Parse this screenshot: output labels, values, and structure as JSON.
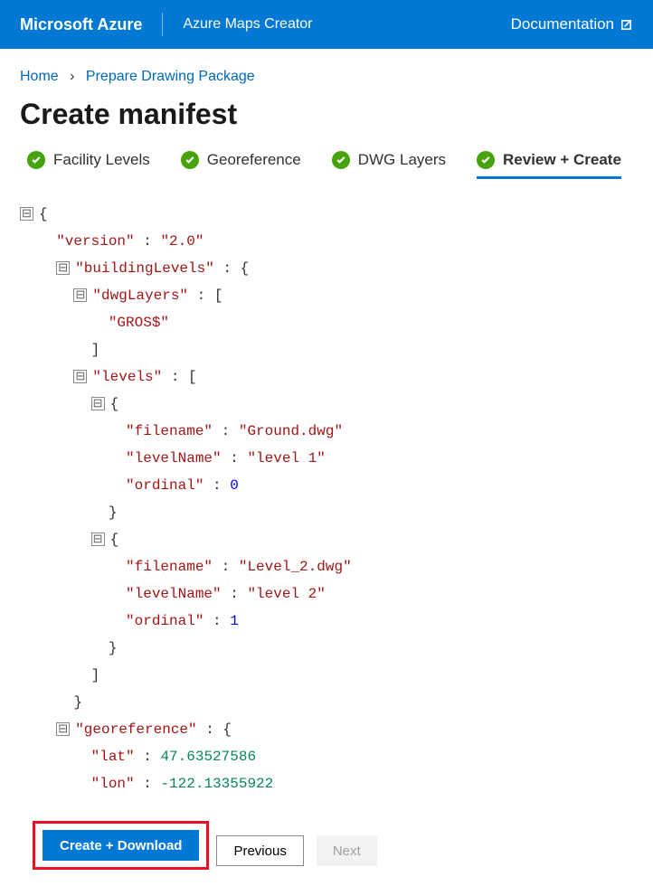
{
  "header": {
    "brand": "Microsoft Azure",
    "product": "Azure Maps Creator",
    "doc_link": "Documentation"
  },
  "breadcrumb": {
    "home": "Home",
    "page": "Prepare Drawing Package"
  },
  "title": "Create manifest",
  "tabs": {
    "facility": "Facility Levels",
    "georef": "Georeference",
    "dwg": "DWG Layers",
    "review": "Review + Create"
  },
  "json": {
    "k_version": "\"version\"",
    "v_version": "\"2.0\"",
    "k_buildingLevels": "\"buildingLevels\"",
    "k_dwgLayers": "\"dwgLayers\"",
    "v_gros": "\"GROS$\"",
    "k_levels": "\"levels\"",
    "k_filename": "\"filename\"",
    "v_ground": "\"Ground.dwg\"",
    "k_levelName": "\"levelName\"",
    "v_level1": "\"level 1\"",
    "k_ordinal": "\"ordinal\"",
    "v_ord0": "0",
    "v_level2dwg": "\"Level_2.dwg\"",
    "v_level2": "\"level 2\"",
    "v_ord1": "1",
    "k_georeference": "\"georeference\"",
    "k_lat": "\"lat\"",
    "v_lat": "47.63527586",
    "k_lon": "\"lon\"",
    "v_lon": "-122.13355922"
  },
  "buttons": {
    "create": "Create + Download",
    "previous": "Previous",
    "next": "Next"
  }
}
